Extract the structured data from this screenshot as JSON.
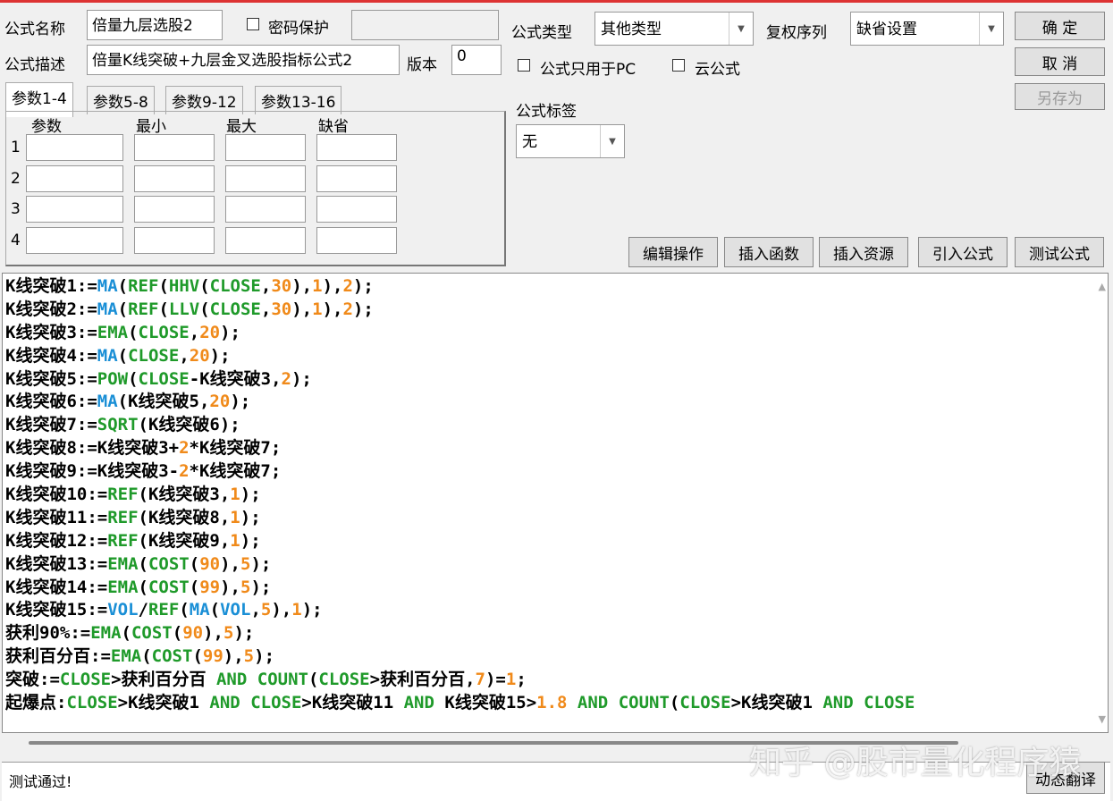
{
  "form": {
    "name_label": "公式名称",
    "name_value": "倍量九层选股2",
    "password_label": "密码保护",
    "desc_label": "公式描述",
    "desc_value": "倍量K线突破+九层金叉选股指标公式2",
    "version_label": "版本",
    "version_value": "0",
    "type_label": "公式类型",
    "type_value": "其他类型",
    "rights_label": "复权序列",
    "rights_value": "缺省设置",
    "pc_only_label": "公式只用于PC",
    "cloud_label": "云公式",
    "tag_label": "公式标签",
    "tag_value": "无"
  },
  "buttons": {
    "ok": "确 定",
    "cancel": "取 消",
    "save_as": "另存为",
    "edit": "编辑操作",
    "insert_func": "插入函数",
    "insert_res": "插入资源",
    "import": "引入公式",
    "test": "测试公式",
    "translate": "动态翻译"
  },
  "tabs": [
    "参数1-4",
    "参数5-8",
    "参数9-12",
    "参数13-16"
  ],
  "params": {
    "headers": [
      "参数",
      "最小",
      "最大",
      "缺省"
    ],
    "rows": [
      "1",
      "2",
      "3",
      "4"
    ]
  },
  "code_lines": [
    [
      [
        "K线突破1:=",
        "t"
      ],
      [
        "MA",
        "b"
      ],
      [
        "(",
        "t"
      ],
      [
        "REF",
        "g"
      ],
      [
        "(",
        "t"
      ],
      [
        "HHV",
        "g"
      ],
      [
        "(",
        "t"
      ],
      [
        "CLOSE",
        "g"
      ],
      [
        ",",
        "t"
      ],
      [
        "30",
        "o"
      ],
      [
        "),",
        "t"
      ],
      [
        "1",
        "o"
      ],
      [
        "),",
        "t"
      ],
      [
        "2",
        "o"
      ],
      [
        ");",
        "t"
      ]
    ],
    [
      [
        "K线突破2:=",
        "t"
      ],
      [
        "MA",
        "b"
      ],
      [
        "(",
        "t"
      ],
      [
        "REF",
        "g"
      ],
      [
        "(",
        "t"
      ],
      [
        "LLV",
        "g"
      ],
      [
        "(",
        "t"
      ],
      [
        "CLOSE",
        "g"
      ],
      [
        ",",
        "t"
      ],
      [
        "30",
        "o"
      ],
      [
        "),",
        "t"
      ],
      [
        "1",
        "o"
      ],
      [
        "),",
        "t"
      ],
      [
        "2",
        "o"
      ],
      [
        ");",
        "t"
      ]
    ],
    [
      [
        "K线突破3:=",
        "t"
      ],
      [
        "EMA",
        "g"
      ],
      [
        "(",
        "t"
      ],
      [
        "CLOSE",
        "g"
      ],
      [
        ",",
        "t"
      ],
      [
        "20",
        "o"
      ],
      [
        ");",
        "t"
      ]
    ],
    [
      [
        "K线突破4:=",
        "t"
      ],
      [
        "MA",
        "b"
      ],
      [
        "(",
        "t"
      ],
      [
        "CLOSE",
        "g"
      ],
      [
        ",",
        "t"
      ],
      [
        "20",
        "o"
      ],
      [
        ");",
        "t"
      ]
    ],
    [
      [
        "K线突破5:=",
        "t"
      ],
      [
        "POW",
        "g"
      ],
      [
        "(",
        "t"
      ],
      [
        "CLOSE",
        "g"
      ],
      [
        "-K线突破3,",
        "t"
      ],
      [
        "2",
        "o"
      ],
      [
        ");",
        "t"
      ]
    ],
    [
      [
        "K线突破6:=",
        "t"
      ],
      [
        "MA",
        "b"
      ],
      [
        "(K线突破5,",
        "t"
      ],
      [
        "20",
        "o"
      ],
      [
        ");",
        "t"
      ]
    ],
    [
      [
        "K线突破7:=",
        "t"
      ],
      [
        "SQRT",
        "g"
      ],
      [
        "(K线突破6);",
        "t"
      ]
    ],
    [
      [
        "K线突破8:=K线突破3+",
        "t"
      ],
      [
        "2",
        "o"
      ],
      [
        "*K线突破7;",
        "t"
      ]
    ],
    [
      [
        "K线突破9:=K线突破3-",
        "t"
      ],
      [
        "2",
        "o"
      ],
      [
        "*K线突破7;",
        "t"
      ]
    ],
    [
      [
        "K线突破10:=",
        "t"
      ],
      [
        "REF",
        "g"
      ],
      [
        "(K线突破3,",
        "t"
      ],
      [
        "1",
        "o"
      ],
      [
        ");",
        "t"
      ]
    ],
    [
      [
        "K线突破11:=",
        "t"
      ],
      [
        "REF",
        "g"
      ],
      [
        "(K线突破8,",
        "t"
      ],
      [
        "1",
        "o"
      ],
      [
        ");",
        "t"
      ]
    ],
    [
      [
        "K线突破12:=",
        "t"
      ],
      [
        "REF",
        "g"
      ],
      [
        "(K线突破9,",
        "t"
      ],
      [
        "1",
        "o"
      ],
      [
        ");",
        "t"
      ]
    ],
    [
      [
        "K线突破13:=",
        "t"
      ],
      [
        "EMA",
        "g"
      ],
      [
        "(",
        "t"
      ],
      [
        "COST",
        "g"
      ],
      [
        "(",
        "t"
      ],
      [
        "90",
        "o"
      ],
      [
        "),",
        "t"
      ],
      [
        "5",
        "o"
      ],
      [
        ");",
        "t"
      ]
    ],
    [
      [
        "K线突破14:=",
        "t"
      ],
      [
        "EMA",
        "g"
      ],
      [
        "(",
        "t"
      ],
      [
        "COST",
        "g"
      ],
      [
        "(",
        "t"
      ],
      [
        "99",
        "o"
      ],
      [
        "),",
        "t"
      ],
      [
        "5",
        "o"
      ],
      [
        ");",
        "t"
      ]
    ],
    [
      [
        "K线突破15:=",
        "t"
      ],
      [
        "VOL",
        "b"
      ],
      [
        "/",
        "t"
      ],
      [
        "REF",
        "g"
      ],
      [
        "(",
        "t"
      ],
      [
        "MA",
        "b"
      ],
      [
        "(",
        "t"
      ],
      [
        "VOL",
        "b"
      ],
      [
        ",",
        "t"
      ],
      [
        "5",
        "o"
      ],
      [
        "),",
        "t"
      ],
      [
        "1",
        "o"
      ],
      [
        ");",
        "t"
      ]
    ],
    [
      [
        "获利90%:=",
        "t"
      ],
      [
        "EMA",
        "g"
      ],
      [
        "(",
        "t"
      ],
      [
        "COST",
        "g"
      ],
      [
        "(",
        "t"
      ],
      [
        "90",
        "o"
      ],
      [
        "),",
        "t"
      ],
      [
        "5",
        "o"
      ],
      [
        ");",
        "t"
      ]
    ],
    [
      [
        "获利百分百:=",
        "t"
      ],
      [
        "EMA",
        "g"
      ],
      [
        "(",
        "t"
      ],
      [
        "COST",
        "g"
      ],
      [
        "(",
        "t"
      ],
      [
        "99",
        "o"
      ],
      [
        "),",
        "t"
      ],
      [
        "5",
        "o"
      ],
      [
        ");",
        "t"
      ]
    ],
    [
      [
        "突破:=",
        "t"
      ],
      [
        "CLOSE",
        "g"
      ],
      [
        ">获利百分百 ",
        "t"
      ],
      [
        "AND",
        "g"
      ],
      [
        " ",
        "t"
      ],
      [
        "COUNT",
        "g"
      ],
      [
        "(",
        "t"
      ],
      [
        "CLOSE",
        "g"
      ],
      [
        ">获利百分百,",
        "t"
      ],
      [
        "7",
        "o"
      ],
      [
        ")=",
        "t"
      ],
      [
        "1",
        "o"
      ],
      [
        ";",
        "t"
      ]
    ],
    [
      [
        "起爆点:",
        "t"
      ],
      [
        "CLOSE",
        "g"
      ],
      [
        ">K线突破1 ",
        "t"
      ],
      [
        "AND",
        "g"
      ],
      [
        " ",
        "t"
      ],
      [
        "CLOSE",
        "g"
      ],
      [
        ">K线突破11 ",
        "t"
      ],
      [
        "AND",
        "g"
      ],
      [
        " K线突破15>",
        "t"
      ],
      [
        "1.8",
        "o"
      ],
      [
        " ",
        "t"
      ],
      [
        "AND",
        "g"
      ],
      [
        " ",
        "t"
      ],
      [
        "COUNT",
        "g"
      ],
      [
        "(",
        "t"
      ],
      [
        "CLOSE",
        "g"
      ],
      [
        ">K线突破1 ",
        "t"
      ],
      [
        "AND",
        "g"
      ],
      [
        " ",
        "t"
      ],
      [
        "CLOSE",
        "g"
      ]
    ]
  ],
  "status": "测试通过!",
  "watermark": "知乎 @股市量化程序猿",
  "colors": {
    "t": "#000000",
    "b": "#1a8fd6",
    "g": "#1f9a2a",
    "o": "#f08a1a"
  }
}
